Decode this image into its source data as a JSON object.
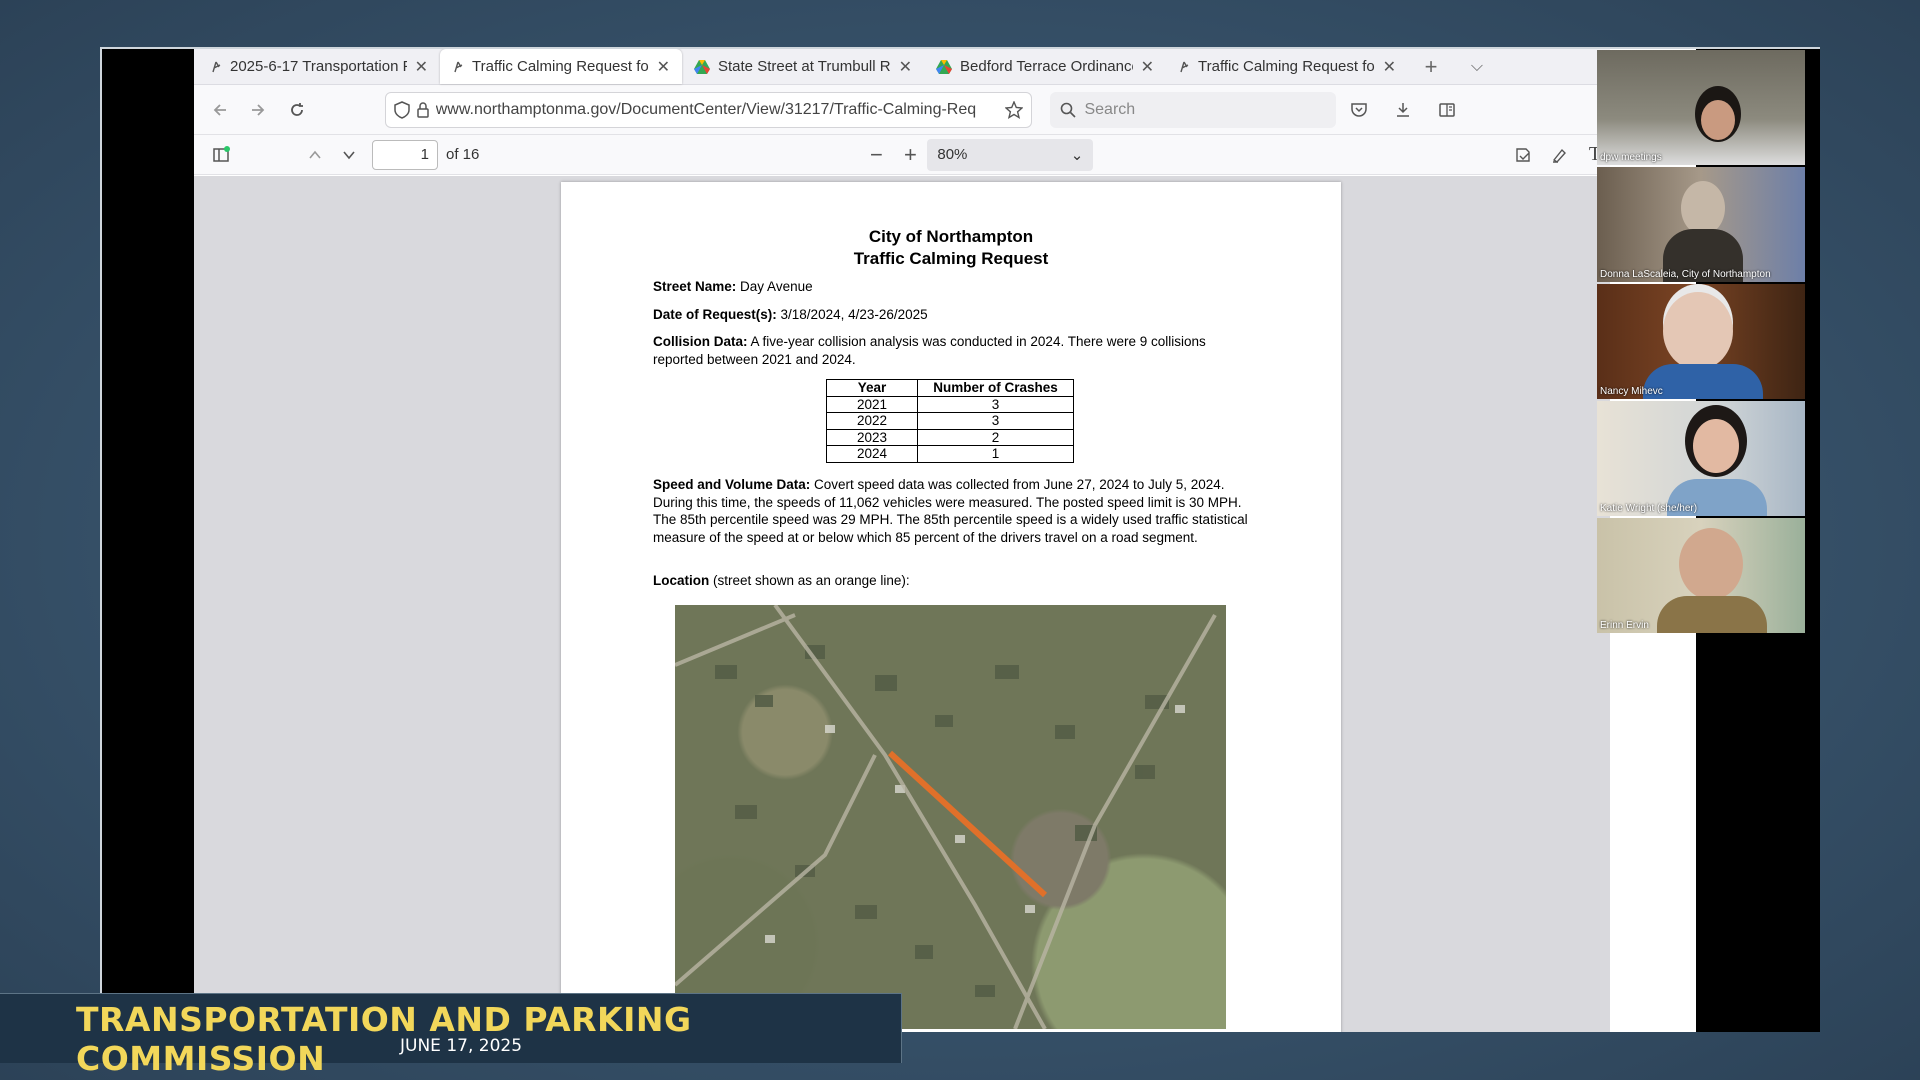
{
  "tabs": [
    {
      "label": "2025-6-17 Transportation P",
      "icon": "northampton-icon",
      "active": false
    },
    {
      "label": "Traffic Calming Request for",
      "icon": "northampton-icon",
      "active": true
    },
    {
      "label": "State Street at Trumbull Roa",
      "icon": "google-drive-icon",
      "active": false
    },
    {
      "label": "Bedford Terrace Ordinance",
      "icon": "google-drive-icon",
      "active": false
    },
    {
      "label": "Traffic Calming Request for",
      "icon": "northampton-icon",
      "active": false
    }
  ],
  "navbar": {
    "url": "www.northamptonma.gov/DocumentCenter/View/31217/Traffic-Calming-Req",
    "search_placeholder": "Search"
  },
  "pdf_toolbar": {
    "page_number": "1",
    "page_total": "of 16",
    "zoom": "80%"
  },
  "document": {
    "title_line1": "City of Northampton",
    "title_line2": "Traffic Calming Request",
    "street_label": "Street Name:",
    "street_value": "Day Avenue",
    "date_label": "Date of Request(s):",
    "date_value": "3/18/2024, 4/23-26/2025",
    "collision_label": "Collision Data:",
    "collision_text": "A five-year collision analysis was conducted in 2024. There were 9 collisions reported between 2021 and 2024.",
    "table_headers": [
      "Year",
      "Number of Crashes"
    ],
    "table_rows": [
      [
        "2021",
        "3"
      ],
      [
        "2022",
        "3"
      ],
      [
        "2023",
        "2"
      ],
      [
        "2024",
        "1"
      ]
    ],
    "speed_label": "Speed and Volume Data:",
    "speed_text": "Covert speed data was collected from June 27, 2024 to July 5, 2024. During this time, the speeds of 11,062 vehicles were measured. The posted speed limit is 30 MPH. The 85th percentile speed was 29 MPH. The 85th percentile speed is a widely used traffic statistical measure of the speed at or below which 85 percent of the drivers travel on a road segment.",
    "location_label": "Location",
    "location_text": "(street shown as an orange line):"
  },
  "participants": [
    {
      "name": "dpw meetings"
    },
    {
      "name": "Donna LaScaleia, City of Northampton"
    },
    {
      "name": "Nancy Mihevc"
    },
    {
      "name": "Katie Wright (she/her)"
    },
    {
      "name": "Erinn Ervin"
    }
  ],
  "lower_third": {
    "title": "TRANSPORTATION AND PARKING COMMISSION",
    "date": "JUNE 17, 2025"
  },
  "colors": {
    "lower_third_title": "#f2d75a",
    "lower_third_bg": "#1e3346",
    "route_line": "#e0702a"
  }
}
